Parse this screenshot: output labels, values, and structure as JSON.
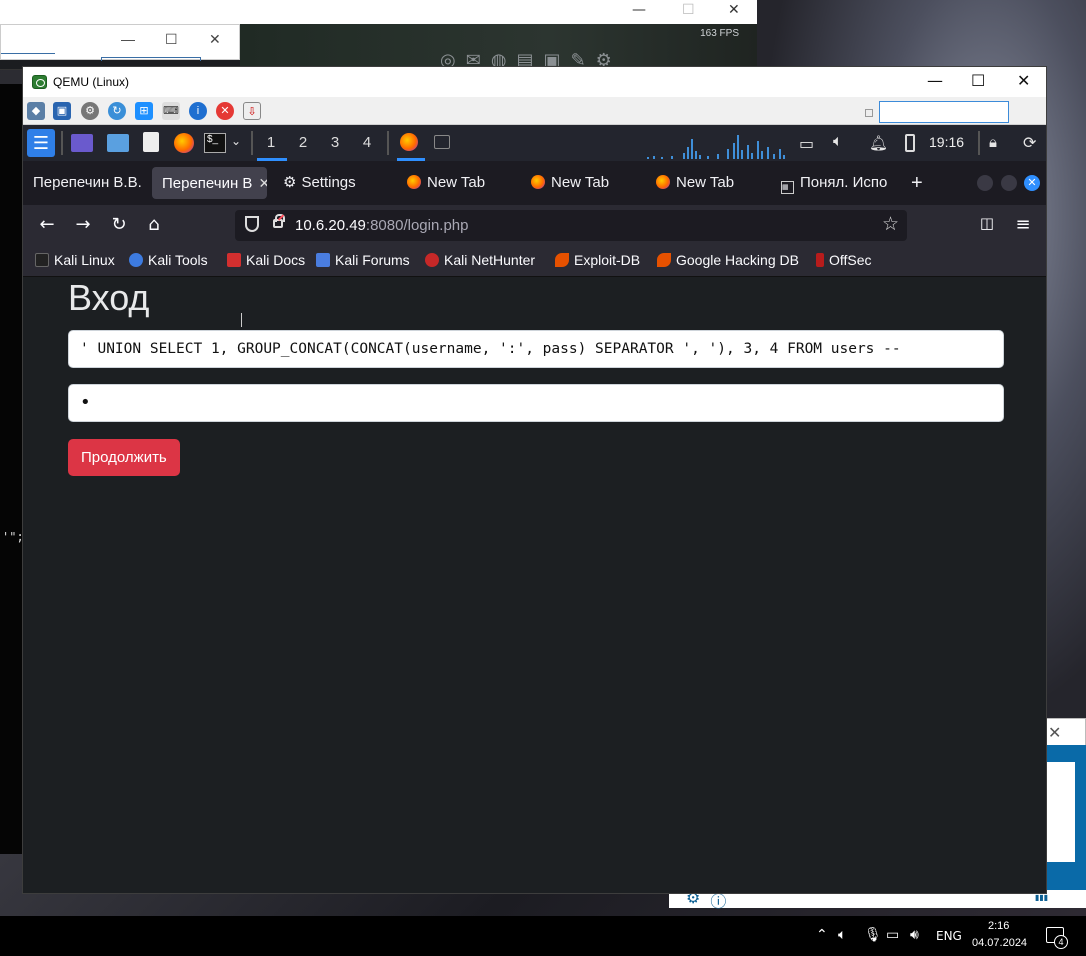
{
  "background": {
    "fps_label": "163 FPS",
    "left_text": "'\";"
  },
  "qemu": {
    "title": "QEMU (Linux)",
    "minimize": "—",
    "maximize": "☐",
    "close": "✕"
  },
  "kali_panel": {
    "workspaces": [
      "1",
      "2",
      "3",
      "4"
    ],
    "clock": "19:16"
  },
  "tabs": [
    {
      "label": "Перепечин В.В."
    },
    {
      "label": "Перепечин В"
    },
    {
      "label": "Settings"
    },
    {
      "label": "New Tab"
    },
    {
      "label": "New Tab"
    },
    {
      "label": "New Tab"
    },
    {
      "label": "Понял. Испо"
    }
  ],
  "new_tab": "+",
  "address": {
    "host": "10.6.20.49",
    "rest": ":8080/login.php"
  },
  "bookmarks": [
    {
      "label": "Kali Linux"
    },
    {
      "label": "Kali Tools"
    },
    {
      "label": "Kali Docs"
    },
    {
      "label": "Kali Forums"
    },
    {
      "label": "Kali NetHunter"
    },
    {
      "label": "Exploit-DB"
    },
    {
      "label": "Google Hacking DB"
    },
    {
      "label": "OffSec"
    }
  ],
  "page": {
    "heading": "Вход",
    "username_value": "' UNION SELECT 1, GROUP_CONCAT(CONCAT(username, ':', pass) SEPARATOR ', '), 3, 4 FROM users --",
    "password_value": "•",
    "submit_label": "Продолжить"
  },
  "taskbar": {
    "language": "ENG",
    "time": "2:16",
    "date": "04.07.2024",
    "notification_count": "4"
  },
  "colors": {
    "submit": "#dc3545",
    "page_bg": "#1c1f22",
    "accent": "#2f8ffe"
  }
}
